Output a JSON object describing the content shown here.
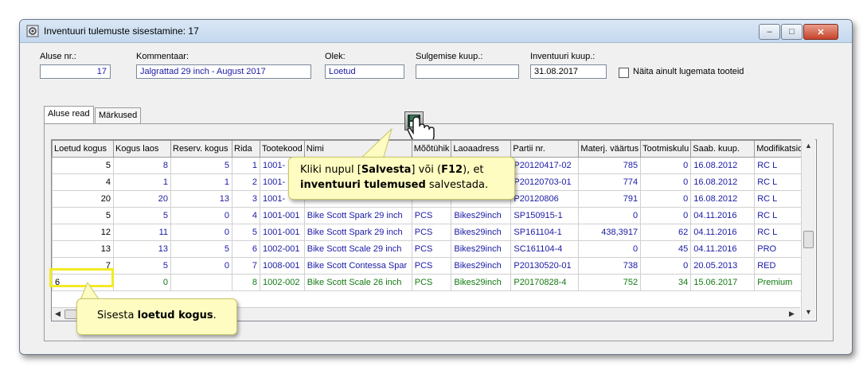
{
  "window": {
    "title": "Inventuuri tulemuste sisestamine: 17",
    "controls": {
      "minimize": "–",
      "maximize": "□",
      "close": "✕"
    }
  },
  "form": {
    "aluse_label": "Aluse nr.:",
    "aluse_value": "17",
    "kommentaar_label": "Kommentaar:",
    "kommentaar_value": "Jalgrattad 29 inch - August 2017",
    "olek_label": "Olek:",
    "olek_value": "Loetud",
    "sulgemise_label": "Sulgemise kuup.:",
    "sulgemise_value": "",
    "inventuuri_label": "Inventuuri kuup.:",
    "inventuuri_value": "31.08.2017",
    "naita_label": "Näita ainult lugemata tooteid"
  },
  "tabs": [
    "Aluse read",
    "Märkused"
  ],
  "grid": {
    "headers": [
      "Loetud kogus",
      "Kogus laos",
      "Reserv. kogus",
      "Rida",
      "Tootekood",
      "Nimi",
      "Mõõtühik",
      "Laoaadress",
      "Partii nr.",
      "Materj. väärtus",
      "Tootmiskulu",
      "Saab. kuup.",
      "Modifikatsioon"
    ],
    "rows": [
      [
        "5",
        "8",
        "5",
        "1",
        "1001-",
        "",
        "",
        "",
        "P20120417-02",
        "785",
        "0",
        "16.08.2012",
        "RC L"
      ],
      [
        "4",
        "1",
        "1",
        "2",
        "1001-",
        "",
        "",
        "",
        "P20120703-01",
        "774",
        "0",
        "16.08.2012",
        "RC L"
      ],
      [
        "20",
        "20",
        "13",
        "3",
        "1001-",
        "",
        "",
        "",
        "P20120806",
        "791",
        "0",
        "16.08.2012",
        "RC L"
      ],
      [
        "5",
        "5",
        "0",
        "4",
        "1001-001",
        "Bike Scott Spark 29 inch",
        "PCS",
        "Bikes29inch",
        "SP150915-1",
        "0",
        "0",
        "04.11.2016",
        "RC L"
      ],
      [
        "12",
        "11",
        "0",
        "5",
        "1001-001",
        "Bike Scott Spark 29 inch",
        "PCS",
        "Bikes29inch",
        "SP161104-1",
        "438,3917",
        "62",
        "04.11.2016",
        "RC L"
      ],
      [
        "13",
        "13",
        "5",
        "6",
        "1002-001",
        "Bike Scott Scale 29 inch",
        "PCS",
        "Bikes29inch",
        "SC161104-4",
        "0",
        "45",
        "04.11.2016",
        "PRO"
      ],
      [
        "7",
        "5",
        "0",
        "7",
        "1008-001",
        "Bike Scott Contessa Spar",
        "PCS",
        "Bikes29inch",
        "P20130520-01",
        "738",
        "0",
        "20.05.2013",
        "RED"
      ],
      [
        "6",
        "0",
        "",
        "8",
        "1002-002",
        "Bike Scott Scale 26 inch",
        "PCS",
        "Bikes29inch",
        "P20170828-4",
        "752",
        "34",
        "15.06.2017",
        "Premium"
      ]
    ]
  },
  "callouts": {
    "save_pre": "Kliki nupul [",
    "save_b1": "Salvesta",
    "save_mid": "] või (",
    "save_b2": "F12",
    "save_end": "), et",
    "save_b3": "inventuuri tulemused",
    "save_tail": " salvestada.",
    "enter_pre": "Sisesta ",
    "enter_b": "loetud kogus",
    "enter_tail": "."
  },
  "colors": {
    "link_blue": "#1a1aa6",
    "green": "#117a11",
    "callout_bg": "#fefcc0",
    "highlight": "#f2ea24"
  }
}
